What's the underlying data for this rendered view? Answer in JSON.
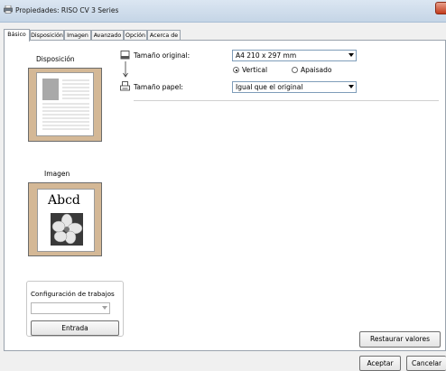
{
  "window": {
    "title": "Propiedades: RISO CV 3 Series"
  },
  "tabs": [
    {
      "label": "Básico"
    },
    {
      "label": "Disposición"
    },
    {
      "label": "Imagen"
    },
    {
      "label": "Avanzado"
    },
    {
      "label": "Opción"
    },
    {
      "label": "Acerca de"
    }
  ],
  "layout_preview": {
    "label": "Disposición"
  },
  "image_preview": {
    "label": "Imagen",
    "sample_text": "Abcd"
  },
  "original_size": {
    "label": "Tamaño original:",
    "value": "A4 210 x 297 mm"
  },
  "orientation": {
    "options": [
      "Vertical",
      "Apaisado"
    ],
    "selected": "Vertical"
  },
  "paper_size": {
    "label": "Tamaño papel:",
    "value": "Igual que el original"
  },
  "job_settings": {
    "label": "Configuración de trabajos",
    "value": "",
    "entry_button": "Entrada"
  },
  "buttons": {
    "restore": "Restaurar valores",
    "accept": "Aceptar",
    "cancel": "Cancelar"
  }
}
